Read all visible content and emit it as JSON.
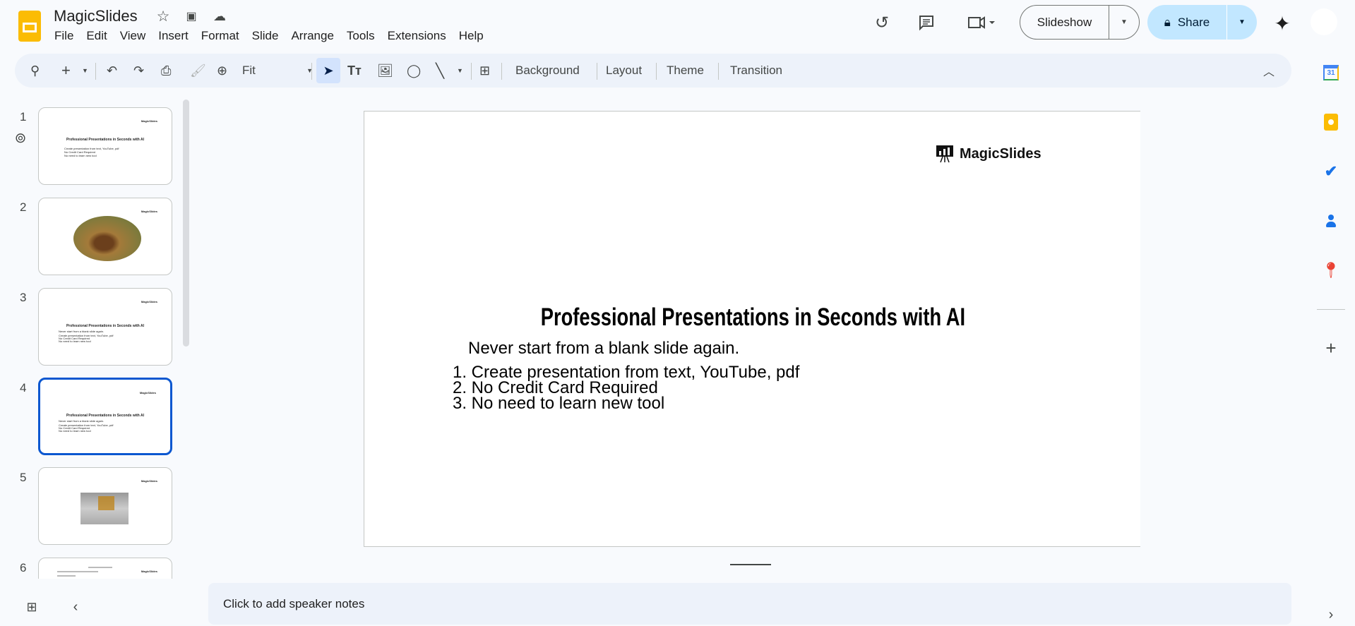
{
  "app": {
    "title": "MagicSlides",
    "menu": [
      "File",
      "Edit",
      "View",
      "Insert",
      "Format",
      "Slide",
      "Arrange",
      "Tools",
      "Extensions",
      "Help"
    ]
  },
  "header": {
    "slideshow_label": "Slideshow",
    "share_label": "Share"
  },
  "toolbar": {
    "zoom_value": "Fit",
    "background": "Background",
    "layout": "Layout",
    "theme": "Theme",
    "transition": "Transition"
  },
  "filmstrip": {
    "numbers": [
      "1",
      "2",
      "3",
      "4",
      "5",
      "6"
    ],
    "logo": "MagicSlides",
    "title": "Professional Presentations in Seconds with AI",
    "subtitle": "Never start from a blank slide again.",
    "bullets": [
      "Create presentation from text, YouTube, pdf",
      "No Credit Card Required",
      "No need to learn new tool"
    ]
  },
  "slide": {
    "logo": "MagicSlides",
    "title": "Professional Presentations in Seconds with AI",
    "subtitle": "Never start from a blank slide again.",
    "list": [
      "1. Create presentation from text, YouTube, pdf",
      "2. No Credit Card Required",
      "3. No need to learn new tool"
    ]
  },
  "notes": {
    "placeholder": "Click to add speaker notes"
  },
  "colors": {
    "accent": "#0b57d0",
    "share_bg": "#c2e7ff",
    "toolbar_bg": "#edf2fa"
  }
}
